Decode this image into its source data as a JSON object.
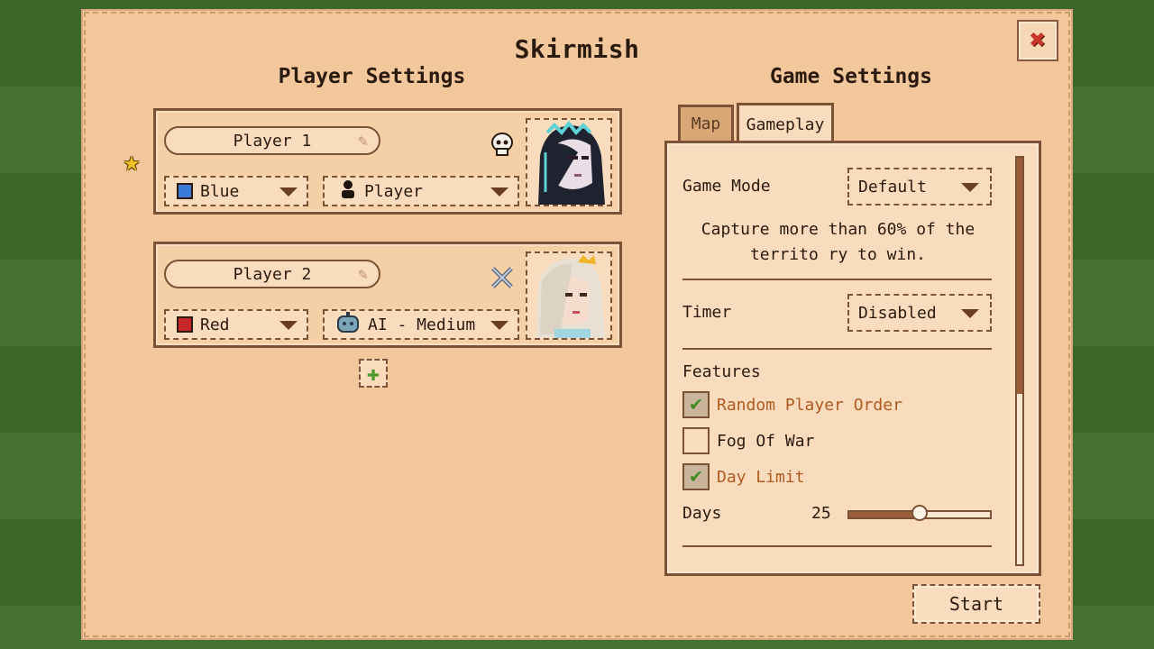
{
  "screen": {
    "title": "Skirmish",
    "close_icon": "close-icon"
  },
  "player_settings": {
    "title": "Player Settings",
    "players": [
      {
        "name": "Player 1",
        "host_star": true,
        "status_icon": "skull-icon",
        "color": {
          "label": "Blue",
          "hex": "#3a7ad8"
        },
        "controller": {
          "label": "Player",
          "icon": "person-icon"
        }
      },
      {
        "name": "Player 2",
        "status_icon": "crossed-swords-icon",
        "color": {
          "label": "Red",
          "hex": "#c8262a"
        },
        "controller": {
          "label": "AI - Medium",
          "icon": "robot-icon"
        }
      }
    ],
    "add_icon": "plus-icon"
  },
  "game_settings": {
    "title": "Game Settings",
    "tabs": [
      "Map",
      "Gameplay"
    ],
    "active_tab": "Gameplay",
    "game_mode": {
      "label": "Game Mode",
      "value": "Default"
    },
    "description": "Capture more than 60% of the territo ry to win.",
    "timer": {
      "label": "Timer",
      "value": "Disabled"
    },
    "features": {
      "label": "Features",
      "items": [
        {
          "label": "Random Player Order",
          "checked": true
        },
        {
          "label": "Fog Of War",
          "checked": false
        },
        {
          "label": "Day Limit",
          "checked": true
        }
      ]
    },
    "days": {
      "label": "Days",
      "value": "25",
      "fraction": 0.5
    }
  },
  "start_label": "Start",
  "colors": {
    "parchment": "#f2c79c",
    "border": "#7b5236",
    "checked_text": "#b05a22",
    "check": "#3f8a22"
  }
}
